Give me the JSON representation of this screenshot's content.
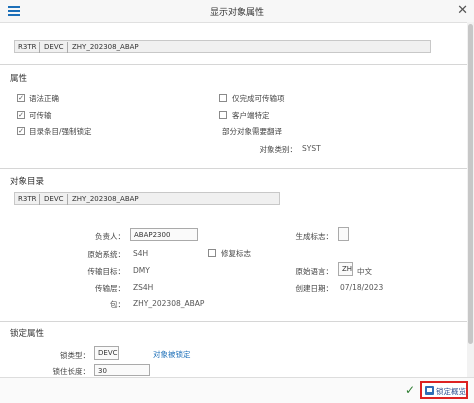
{
  "window": {
    "title": "显示对象属性"
  },
  "object_key": {
    "pgmid": "R3TR",
    "type": "DEVC",
    "name": "ZHY_202308_ABAP"
  },
  "attributes": {
    "heading": "属性",
    "syntax_ok": {
      "label": "语法正确",
      "checked": true
    },
    "transportable": {
      "label": "可传输",
      "checked": true
    },
    "dir_locked": {
      "label": "目录条目/强制锁定",
      "checked": true
    },
    "complete_only": {
      "label": "仅完成可传输项",
      "checked": false
    },
    "client_specific": {
      "label": "客户端特定",
      "checked": false
    },
    "partial_translate": "部分对象需要翻译",
    "object_category_label": "对象类别：",
    "object_category_value": "SYST"
  },
  "directory": {
    "heading": "对象目录",
    "pgmid": "R3TR",
    "type": "DEVC",
    "name": "ZHY_202308_ABAP",
    "responsible_label": "负责人：",
    "responsible": "ABAP2300",
    "generated_label": "生成标志：",
    "source_system_label": "原始系统：",
    "source_system": "S4H",
    "repair_label": "修复标志",
    "target_label": "传输目标：",
    "target": "DMY",
    "orig_lang_label": "原始语言：",
    "orig_lang": "ZH",
    "orig_lang_text": "中文",
    "layer_label": "传输层：",
    "layer": "ZS4H",
    "created_label": "创建日期：",
    "created": "07/18/2023",
    "package_label": "包：",
    "package": "ZHY_202308_ABAP"
  },
  "lock": {
    "heading": "锁定属性",
    "type_label": "锁类型：",
    "type": "DEVC",
    "status_link": "对象被锁定",
    "partial_label": "锁住长度：",
    "partial": "30"
  },
  "footer": {
    "ok_symbol": "✓",
    "lock_overview": "锁定概览"
  }
}
